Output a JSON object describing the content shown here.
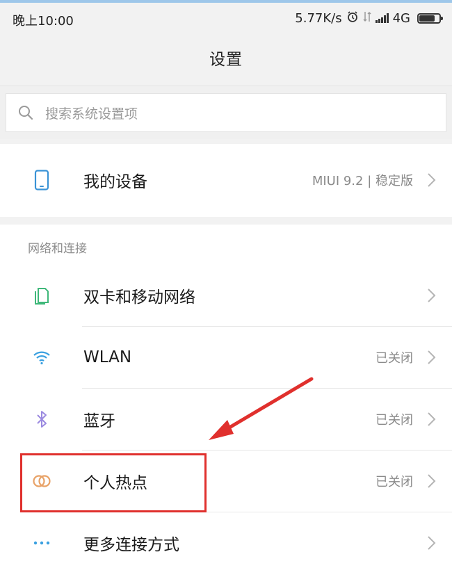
{
  "status_bar": {
    "time": "晚上10:00",
    "net_speed": "5.77K/s",
    "alarm_icon": "alarm-clock-icon",
    "data_icon": "data-arrows-icon",
    "signal_icon": "signal-bars-icon",
    "network_type": "4G",
    "battery_icon": "battery-icon"
  },
  "header": {
    "title": "设置"
  },
  "search": {
    "placeholder": "搜索系统设置项",
    "icon": "search-icon"
  },
  "device": {
    "label": "我的设备",
    "value": "MIUI 9.2 | 稳定版",
    "icon": "phone-icon"
  },
  "network_section": {
    "title": "网络和连接",
    "items": [
      {
        "label": "双卡和移动网络",
        "value": "",
        "icon": "sim-card-icon"
      },
      {
        "label": "WLAN",
        "value": "已关闭",
        "icon": "wifi-icon"
      },
      {
        "label": "蓝牙",
        "value": "已关闭",
        "icon": "bluetooth-icon"
      },
      {
        "label": "个人热点",
        "value": "已关闭",
        "icon": "hotspot-icon"
      },
      {
        "label": "更多连接方式",
        "value": "",
        "icon": "more-dots-icon"
      }
    ]
  },
  "annotation": {
    "highlight_color": "#e0302d",
    "arrow_color": "#e0302d"
  }
}
